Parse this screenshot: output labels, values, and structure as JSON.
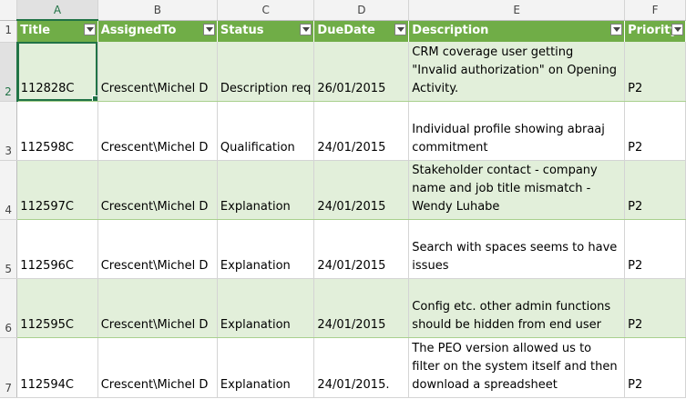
{
  "columns": [
    {
      "letter": "A",
      "header": "Title"
    },
    {
      "letter": "B",
      "header": "AssignedTo"
    },
    {
      "letter": "C",
      "header": "Status"
    },
    {
      "letter": "D",
      "header": "DueDate"
    },
    {
      "letter": "E",
      "header": "Description"
    },
    {
      "letter": "F",
      "header": "Priority"
    }
  ],
  "row_numbers": [
    "1",
    "2",
    "3",
    "4",
    "5",
    "6",
    "7"
  ],
  "rows": [
    {
      "title": "112828C",
      "assigned_to": "Crescent\\Michel D",
      "status": "Description req",
      "due_date": "26/01/2015",
      "description": "CRM coverage user getting \"Invalid authorization\" on Opening Activity.",
      "priority": "P2"
    },
    {
      "title": "112598C",
      "assigned_to": "Crescent\\Michel D",
      "status": "Qualification",
      "due_date": "24/01/2015",
      "description": "Individual profile showing abraaj commitment",
      "priority": "P2"
    },
    {
      "title": "112597C",
      "assigned_to": "Crescent\\Michel D",
      "status": "Explanation",
      "due_date": "24/01/2015",
      "description": "Stakeholder contact - company name and job title mismatch - Wendy Luhabe",
      "priority": "P2"
    },
    {
      "title": "112596C",
      "assigned_to": "Crescent\\Michel D",
      "status": "Explanation",
      "due_date": "24/01/2015",
      "description": "Search with spaces seems to have issues",
      "priority": "P2"
    },
    {
      "title": "112595C",
      "assigned_to": "Crescent\\Michel D",
      "status": "Explanation",
      "due_date": "24/01/2015",
      "description": "Config etc. other admin functions should be hidden from end user",
      "priority": "P2"
    },
    {
      "title": "112594C",
      "assigned_to": "Crescent\\Michel D",
      "status": "Explanation",
      "due_date": "24/01/2015.",
      "description": "The PEO version allowed us to filter on the system itself and then download a spreadsheet",
      "priority": "P2"
    }
  ],
  "icons": {
    "filter": "dropdown-arrow-icon"
  },
  "colors": {
    "header_bg": "#70ad47",
    "band_bg": "#e2efda",
    "selection": "#217346"
  }
}
